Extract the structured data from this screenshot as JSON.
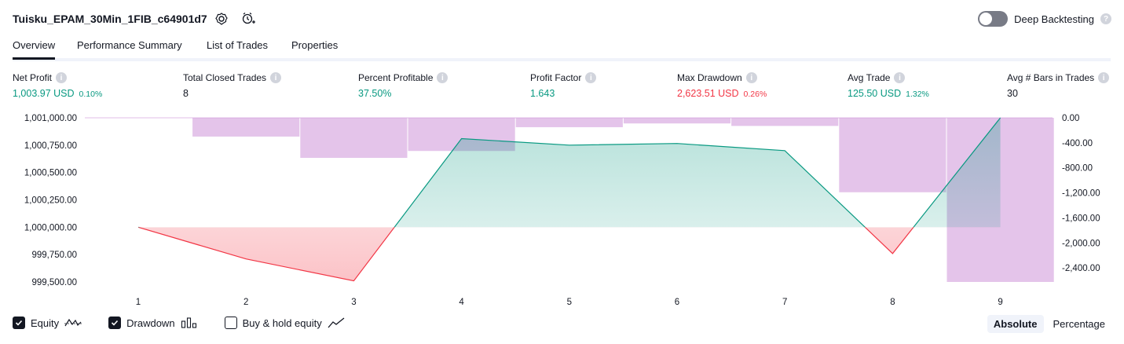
{
  "header": {
    "strategy_name": "Tuisku_EPAM_30Min_1FIB_c64901d7",
    "deep_backtesting_label": "Deep Backtesting",
    "help_glyph": "?"
  },
  "tabs": [
    {
      "label": "Overview",
      "active": true
    },
    {
      "label": "Performance Summary",
      "active": false
    },
    {
      "label": "List of Trades",
      "active": false
    },
    {
      "label": "Properties",
      "active": false
    }
  ],
  "metrics": [
    {
      "label": "Net Profit",
      "value": "1,003.97 USD",
      "sub": "0.10%",
      "tone": "pos"
    },
    {
      "label": "Total Closed Trades",
      "value": "8",
      "sub": "",
      "tone": "neu"
    },
    {
      "label": "Percent Profitable",
      "value": "37.50%",
      "sub": "",
      "tone": "pos"
    },
    {
      "label": "Profit Factor",
      "value": "1.643",
      "sub": "",
      "tone": "pos"
    },
    {
      "label": "Max Drawdown",
      "value": "2,623.51 USD",
      "sub": "0.26%",
      "tone": "neg"
    },
    {
      "label": "Avg Trade",
      "value": "125.50 USD",
      "sub": "1.32%",
      "tone": "pos"
    },
    {
      "label": "Avg # Bars in Trades",
      "value": "30",
      "sub": "",
      "tone": "neu"
    }
  ],
  "chart_data": {
    "type": "line",
    "x": [
      1,
      2,
      3,
      4,
      5,
      6,
      7,
      8,
      9
    ],
    "equity": [
      1000000,
      999710,
      999510,
      1000810,
      1000750,
      1000765,
      1000700,
      999760,
      1001000
    ],
    "equity_baseline": 1000000,
    "drawdown_bars": [
      {
        "trade": 2,
        "value": -300
      },
      {
        "trade": 3,
        "value": -640
      },
      {
        "trade": 4,
        "value": -530
      },
      {
        "trade": 5,
        "value": -150
      },
      {
        "trade": 6,
        "value": -90
      },
      {
        "trade": 7,
        "value": -130
      },
      {
        "trade": 8,
        "value": -1190
      },
      {
        "trade": 9,
        "value": -2623.51
      }
    ],
    "left_axis": {
      "ticks": [
        "1,001,000.00",
        "1,000,750.00",
        "1,000,500.00",
        "1,000,250.00",
        "1,000,000.00",
        "999,750.00",
        "999,500.00"
      ],
      "range": [
        999500,
        1001000
      ]
    },
    "right_axis": {
      "ticks": [
        "0.00",
        "-400.00",
        "-800.00",
        "-1,200.00",
        "-1,600.00",
        "-2,000.00",
        "-2,400.00"
      ],
      "range": [
        -2623.51,
        0
      ]
    },
    "x_tick_labels": [
      "1",
      "2",
      "3",
      "4",
      "5",
      "6",
      "7",
      "8",
      "9"
    ],
    "colors": {
      "up": "#089981",
      "down": "#f23645",
      "drawdown": "#ce93d8"
    }
  },
  "legend": {
    "equity_label": "Equity",
    "drawdown_label": "Drawdown",
    "buyhold_label": "Buy & hold equity",
    "equity_checked": true,
    "drawdown_checked": true,
    "buyhold_checked": false
  },
  "view_toggle": {
    "absolute_label": "Absolute",
    "percentage_label": "Percentage",
    "selected": "Absolute"
  }
}
